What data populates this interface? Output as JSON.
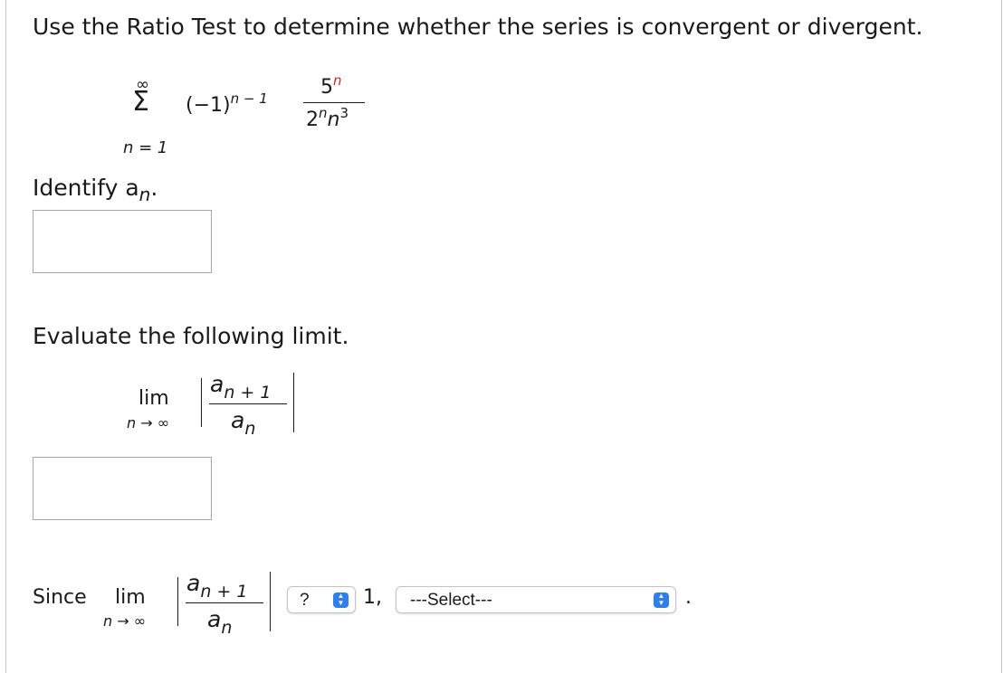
{
  "question": {
    "prompt": "Use the Ratio Test to determine whether the series is convergent or divergent."
  },
  "series": {
    "sum_symbol": "Σ",
    "upper_limit": "∞",
    "lower_limit": "n = 1",
    "sign_base": "(−1)",
    "sign_exponent": "n − 1",
    "numerator_base": "5",
    "numerator_exponent": "n",
    "denominator_base": "2",
    "denominator_exponent": "n",
    "denominator_variable": "n",
    "denominator_variable_exponent": "3"
  },
  "part_an": {
    "label": "Identify a",
    "label_subscript": "n",
    "label_suffix": ".",
    "answer_value": ""
  },
  "part_limit": {
    "label": "Evaluate the following limit.",
    "lim": "lim",
    "lim_under": "n → ∞",
    "num_base": "a",
    "num_subscript": "n + 1",
    "den_base": "a",
    "den_subscript": "n",
    "answer_value": ""
  },
  "conclusion": {
    "since": "Since",
    "lim": "lim",
    "lim_under": "n → ∞",
    "num_base": "a",
    "num_subscript": "n + 1",
    "den_base": "a",
    "den_subscript": "n",
    "comparison_select": "?",
    "comparison_value": "1,",
    "result_select": "---Select---",
    "end": "."
  },
  "colors": {
    "highlight": "#d42a1e",
    "select_accent": "#2d7ff0",
    "input_border": "#a6a6a6"
  }
}
